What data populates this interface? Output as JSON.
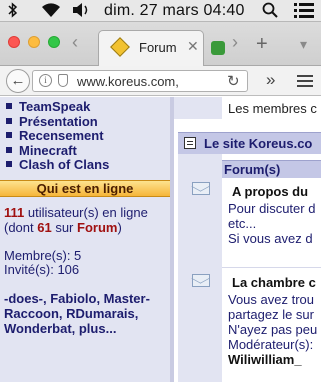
{
  "menubar": {
    "clock": "dim. 27 mars  04:40",
    "icons": [
      "bluetooth-icon",
      "wifi-icon",
      "volume-icon",
      "search-icon",
      "list-icon"
    ]
  },
  "browser": {
    "tab_title": "Forum",
    "tab_close": "✕",
    "url": "www.koreus.com,",
    "back_glyph": "←",
    "reload_glyph": "↻",
    "overflow_glyph": "»",
    "plus_glyph": "+"
  },
  "sidebar": {
    "links": [
      "TeamSpeak",
      "Présentation",
      "Recensement",
      "Minecraft",
      "Clash of Clans"
    ],
    "online_title": "Qui est en ligne",
    "online_count": "111",
    "online_text_1": " utilisateur(s) en ligne",
    "online_text_2_prefix": "(dont ",
    "online_forum_count": "61",
    "online_text_2_mid": " sur ",
    "online_forum_word": "Forum",
    "online_text_2_suffix": ")",
    "members": "Membre(s): 5",
    "guests": "Invité(s): 106",
    "names": "-does-, Fabiolo, Master-Raccoon, RDumarais, Wonderbat, plus..."
  },
  "content": {
    "top_text": "Les membres c",
    "section_title": "Le site Koreus.co",
    "column_header": "Forum(s)",
    "rows": [
      {
        "title": "A propos du",
        "desc": [
          "Pour discuter d",
          "etc...",
          "Si vous avez d"
        ]
      },
      {
        "title": "La chambre c",
        "desc": [
          "Vous avez trou",
          "partagez le sur",
          "N'ayez pas peu",
          "Modérateur(s):"
        ],
        "moderator": "Wiliwilliam_"
      }
    ]
  }
}
